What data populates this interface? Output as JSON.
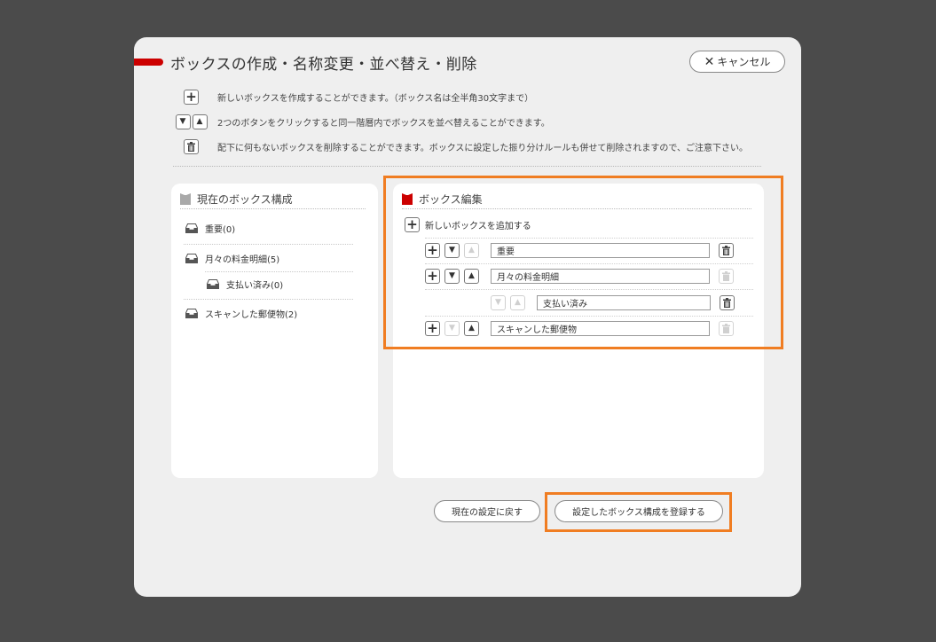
{
  "dialog": {
    "title": "ボックスの作成・名称変更・並べ替え・削除",
    "cancel_label": "キャンセル",
    "cancel_icon": "close-icon"
  },
  "help": [
    {
      "icon": "plus-icon",
      "text": "新しいボックスを作成することができます。（ボックス名は全半角30文字まで）"
    },
    {
      "icon": "move-down-up-icons",
      "text": "2つのボタンをクリックすると同一階層内でボックスを並べ替えることができます。"
    },
    {
      "icon": "trash-icon",
      "text": "配下に何もないボックスを削除することができます。ボックスに設定した振り分けルールも併せて削除されますので、ご注意下さい。"
    }
  ],
  "current_panel": {
    "title": "現在のボックス構成",
    "items": [
      {
        "label": "重要(0)",
        "level": 0
      },
      {
        "label": "月々の料金明細(5)",
        "level": 0
      },
      {
        "label": "支払い済み(0)",
        "level": 1
      },
      {
        "label": "スキャンした郵便物(2)",
        "level": 0
      }
    ]
  },
  "edit_panel": {
    "title": "ボックス編集",
    "add_label": "新しいボックスを追加する",
    "rows": [
      {
        "value": "重要",
        "level": 0,
        "has_add": true,
        "down_enabled": true,
        "up_enabled": false,
        "trash_enabled": true
      },
      {
        "value": "月々の料金明細",
        "level": 0,
        "has_add": true,
        "down_enabled": true,
        "up_enabled": true,
        "trash_enabled": false
      },
      {
        "value": "支払い済み",
        "level": 1,
        "has_add": false,
        "down_enabled": false,
        "up_enabled": false,
        "trash_enabled": true
      },
      {
        "value": "スキャンした郵便物",
        "level": 0,
        "has_add": true,
        "down_enabled": false,
        "up_enabled": true,
        "trash_enabled": false
      }
    ]
  },
  "footer": {
    "reset_label": "現在の設定に戻す",
    "submit_label": "設定したボックス構成を登録する"
  },
  "colors": {
    "accent": "#cc0000",
    "highlight": "#f07d22",
    "backdrop": "#4b4b4b",
    "dialog_bg": "#efefef"
  }
}
